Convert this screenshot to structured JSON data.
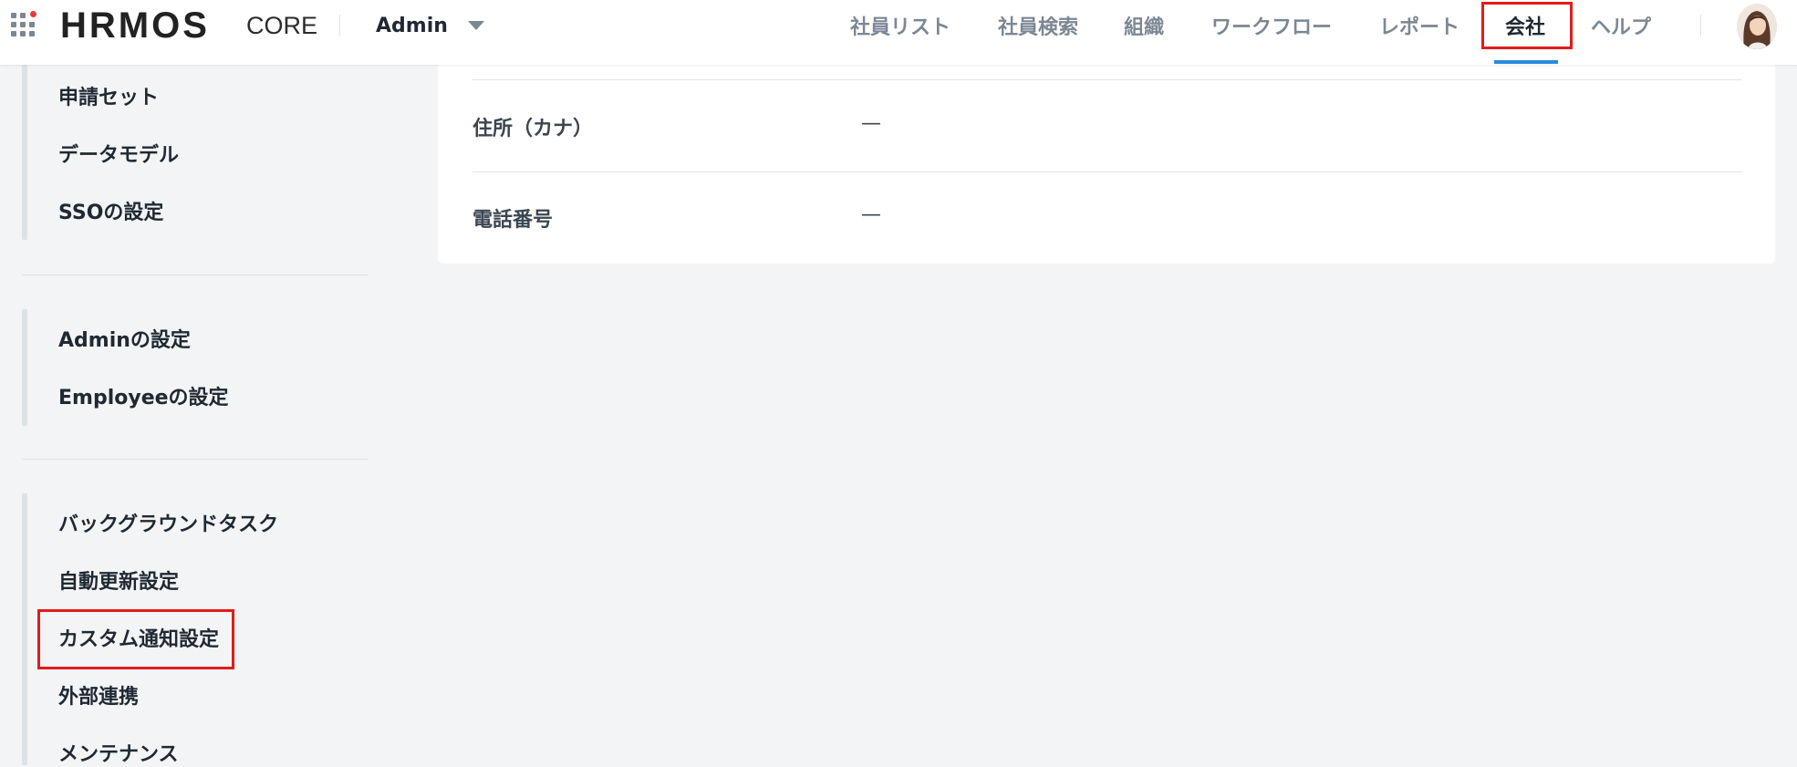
{
  "header": {
    "logo_text": "HRMOS",
    "logo_sub": "CORE",
    "role_select": {
      "value": "Admin",
      "icon": "chevron-down-icon"
    },
    "nav": [
      {
        "label": "社員リスト",
        "active": false
      },
      {
        "label": "社員検索",
        "active": false
      },
      {
        "label": "組織",
        "active": false
      },
      {
        "label": "ワークフロー",
        "active": false
      },
      {
        "label": "レポート",
        "active": false
      },
      {
        "label": "会社",
        "active": true,
        "highlighted": true
      },
      {
        "label": "ヘルプ",
        "active": false
      }
    ],
    "accent_color": "#2b8be0",
    "highlight_color": "#e31b1b"
  },
  "sidebar": {
    "groups": [
      {
        "items": [
          "申請セット",
          "データモデル",
          "SSOの設定"
        ]
      },
      {
        "items": [
          "Adminの設定",
          "Employeeの設定"
        ]
      },
      {
        "items": [
          "バックグラウンドタスク",
          "自動更新設定",
          "カスタム通知設定",
          "外部連携",
          "メンテナンス"
        ]
      }
    ],
    "highlighted_item": "カスタム通知設定"
  },
  "main": {
    "rows": [
      {
        "label": "住所（カナ）",
        "value": "—"
      },
      {
        "label": "電話番号",
        "value": "—"
      }
    ]
  }
}
